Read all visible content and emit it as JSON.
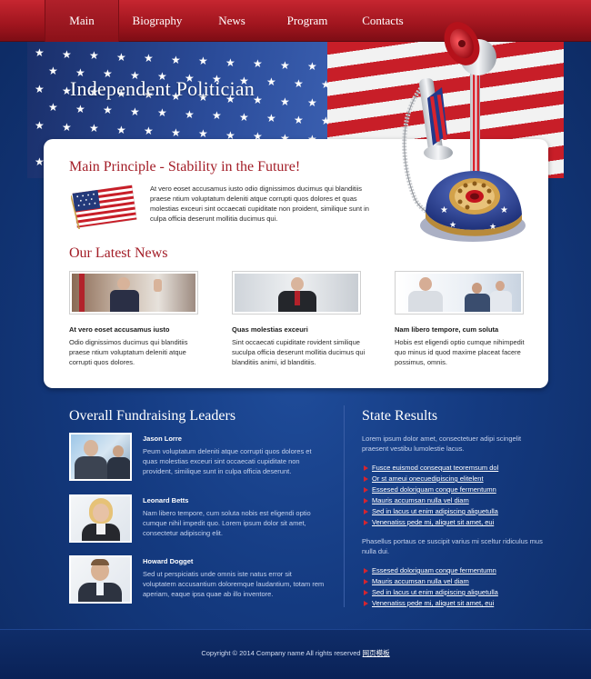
{
  "nav": {
    "items": [
      {
        "label": "Main",
        "active": true
      },
      {
        "label": "Biography",
        "active": false
      },
      {
        "label": "News",
        "active": false
      },
      {
        "label": "Program",
        "active": false
      },
      {
        "label": "Contacts",
        "active": false
      }
    ]
  },
  "hero": {
    "title": "Independent Politician"
  },
  "principle": {
    "title": "Main Principle - Stability in the Future!",
    "text": "At vero eoset accusamus iusto odio dignissimos ducimus qui blanditiis praese ntium voluptatum deleniti atque corrupti quos dolores et quas molestias exceuri sint occaecati cupiditate non proident, similique sunt in culpa officia deserunt mollitia ducimus qui."
  },
  "news": {
    "title": "Our Latest News",
    "items": [
      {
        "title": "At vero eoset accusamus iusto",
        "text": "Odio dignissimos ducimus qui blanditiis praese ntium voluptatum deleniti atque corrupti quos dolores."
      },
      {
        "title": "Quas molestias exceuri",
        "text": "Sint occaecati cupiditate rovident similique suculpa officia deserunt mollitia ducimus qui blanditiis animi, id blanditiis."
      },
      {
        "title": "Nam libero tempore, cum soluta",
        "text": "Hobis est eligendi optio cumque nihimpedit quo minus id quod maxime placeat facere possimus, omnis."
      }
    ]
  },
  "fundraising": {
    "title": "Overall Fundraising Leaders",
    "leaders": [
      {
        "name": "Jason Lorre",
        "text": "Peum voluptatum deleniti atque corrupti quos dolores et quas molestias exceuri sint occaecati cupiditate non provident, similique sunt in culpa officia deserunt."
      },
      {
        "name": "Leonard Betts",
        "text": "Nam libero tempore, cum soluta nobis est eligendi optio cumque nihil impedit quo. Lorem ipsum dolor sit amet, consectetur adipiscing elit."
      },
      {
        "name": "Howard Dogget",
        "text": "Sed ut perspiciatis unde omnis iste natus error sit voluptatem accusantium doloremque laudantium, totam rem aperiam, eaque ipsa quae ab illo inventore."
      }
    ]
  },
  "state": {
    "title": "State Results",
    "intro": "Lorem ipsum dolor amet, consectetuer adipi scingelit praesent vestibu lumolestie lacus.",
    "links1": [
      "Fusce euismod consequat teoremsum dol",
      "Or st ameui onecuedipiscing elitelent",
      "Essesed doloriguam conque fermentumn",
      "Mauris accumsan nulla vel diam",
      "Sed in lacus ut enim adipiscing aliquetulla",
      "Venenatiss pede mi, aliquet sit amet, eui"
    ],
    "middle": "Phasellus portaus ce suscipit varius mi sceltur ridiculus mus nulla dui.",
    "links2": [
      "Essesed doloriguam conque fermentumn",
      "Mauris accumsan nulla vel diam",
      "Sed in lacus ut enim adipiscing aliquetulla",
      "Venenatiss pede mi, aliquet sit amet, eui"
    ]
  },
  "footer": {
    "copyright": "Copyright © 2014 Company name All rights reserved",
    "link": "网页模板"
  },
  "colors": {
    "nav_red": "#a0151e",
    "accent_red": "#a31d27",
    "background_blue": "#143a80",
    "panel": "#ffffff"
  }
}
